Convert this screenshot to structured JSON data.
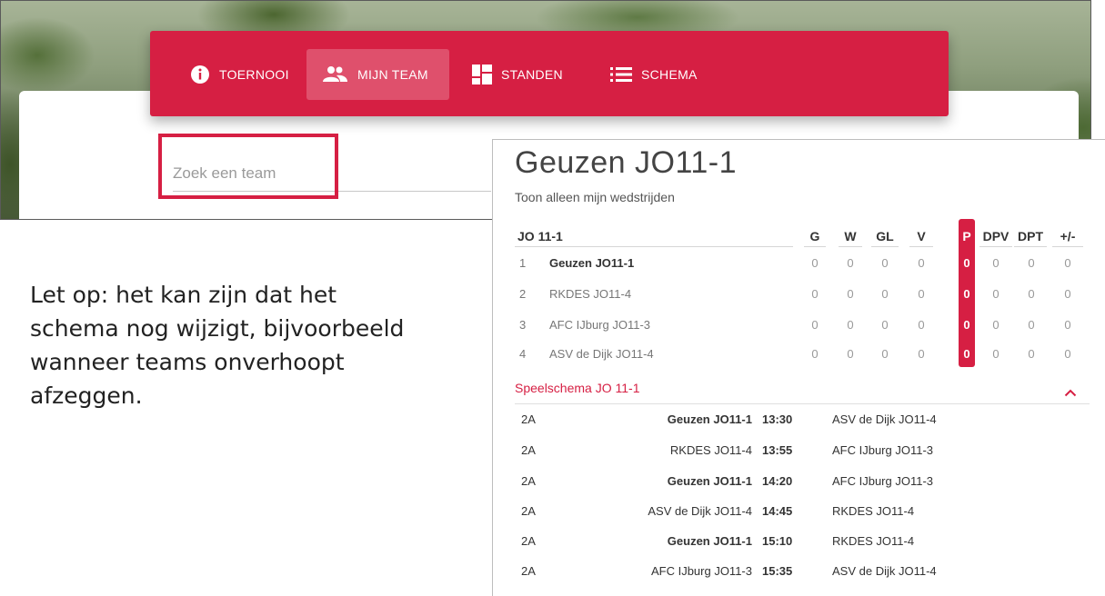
{
  "nav": {
    "items": [
      {
        "label": "TOERNOOI",
        "icon": "info-icon"
      },
      {
        "label": "MIJN TEAM",
        "icon": "people-icon",
        "active": true
      },
      {
        "label": "STANDEN",
        "icon": "dashboard-icon"
      },
      {
        "label": "SCHEMA",
        "icon": "list-icon"
      }
    ],
    "color": "#d61f43"
  },
  "search": {
    "placeholder": "Zoek een team"
  },
  "note": "Let op: het kan zijn dat het schema nog wijzigt, bijvoorbeeld wanneer teams onverhoopt afzeggen.",
  "panel": {
    "title": "Geuzen JO11-1",
    "toggle": "Toon alleen mijn wedstrijden",
    "standings": {
      "group": "JO 11-1",
      "columns": [
        "G",
        "W",
        "GL",
        "V",
        "P",
        "DPV",
        "DPT",
        "+/-"
      ],
      "rows": [
        {
          "pos": "1",
          "team": "Geuzen JO11-1",
          "values": [
            "0",
            "0",
            "0",
            "0",
            "0",
            "0",
            "0",
            "0"
          ]
        },
        {
          "pos": "2",
          "team": "RKDES JO11-4",
          "values": [
            "0",
            "0",
            "0",
            "0",
            "0",
            "0",
            "0",
            "0"
          ]
        },
        {
          "pos": "3",
          "team": "AFC IJburg JO11-3",
          "values": [
            "0",
            "0",
            "0",
            "0",
            "0",
            "0",
            "0",
            "0"
          ]
        },
        {
          "pos": "4",
          "team": "ASV de Dijk JO11-4",
          "values": [
            "0",
            "0",
            "0",
            "0",
            "0",
            "0",
            "0",
            "0"
          ]
        }
      ]
    },
    "schedule": {
      "title": "Speelschema JO 11-1",
      "matches": [
        {
          "field": "2A",
          "home": "Geuzen JO11-1",
          "time": "13:30",
          "away": "ASV de Dijk JO11-4"
        },
        {
          "field": "2A",
          "home": "RKDES JO11-4",
          "time": "13:55",
          "away": "AFC IJburg JO11-3"
        },
        {
          "field": "2A",
          "home": "Geuzen JO11-1",
          "time": "14:20",
          "away": "AFC IJburg JO11-3"
        },
        {
          "field": "2A",
          "home": "ASV de Dijk JO11-4",
          "time": "14:45",
          "away": "RKDES JO11-4"
        },
        {
          "field": "2A",
          "home": "Geuzen JO11-1",
          "time": "15:10",
          "away": "RKDES JO11-4"
        },
        {
          "field": "2A",
          "home": "AFC IJburg JO11-3",
          "time": "15:35",
          "away": "ASV de Dijk JO11-4"
        }
      ]
    }
  }
}
